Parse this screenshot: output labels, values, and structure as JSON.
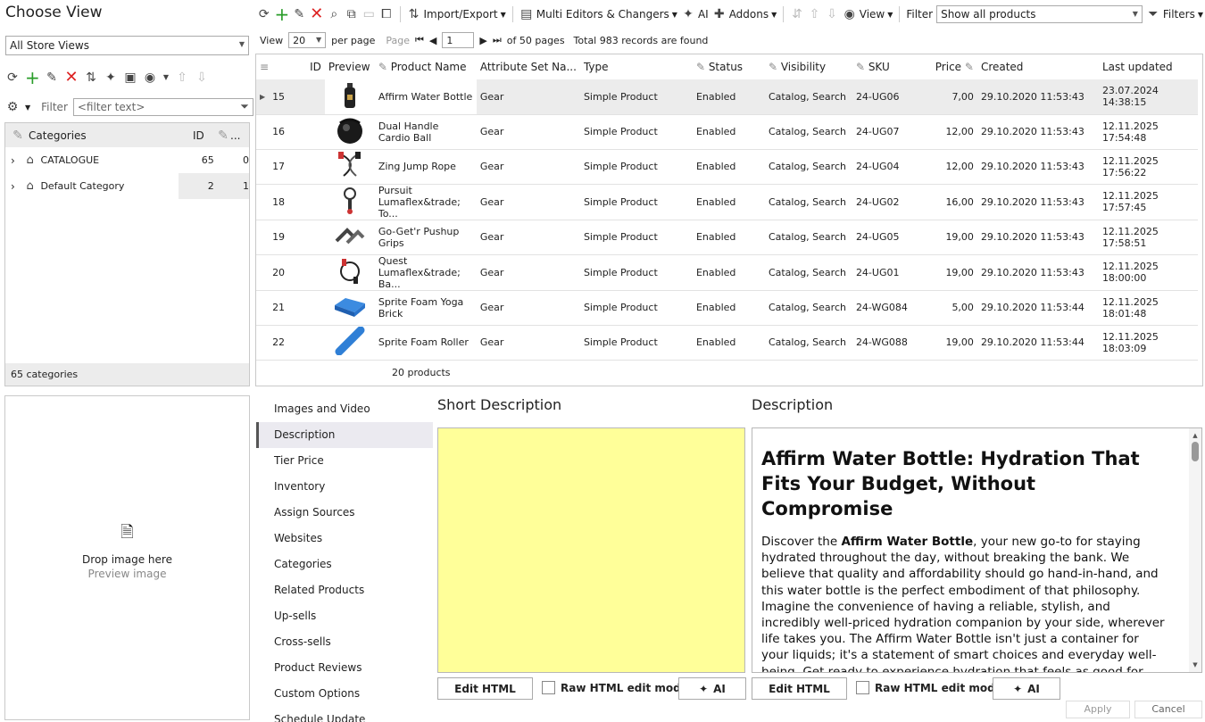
{
  "left": {
    "title": "Choose View",
    "store_view": "All Store Views",
    "filter_label": "Filter",
    "filter_placeholder": "<filter text>",
    "tree_header": {
      "name": "Categories",
      "id": "ID",
      "more": "..."
    },
    "categories": [
      {
        "name": "CATALOGUE",
        "id": "65",
        "count": "0"
      },
      {
        "name": "Default Category",
        "id": "2",
        "count": "1"
      }
    ],
    "footer": "65 categories",
    "dropzone": {
      "title": "Drop image here",
      "subtitle": "Preview image"
    }
  },
  "toolbar": {
    "import_export": "Import/Export",
    "multi_editors": "Multi Editors & Changers",
    "ai": "AI",
    "addons": "Addons",
    "view": "View",
    "filter_label": "Filter",
    "filter_value": "Show all products",
    "filters": "Filters"
  },
  "pager": {
    "view_label": "View",
    "per_page_value": "20",
    "per_page_label": "per page",
    "page_label": "Page",
    "page_value": "1",
    "of_pages": "of 50 pages",
    "total": "Total 983 records are found"
  },
  "grid": {
    "columns": [
      "ID",
      "Preview",
      "Product Name",
      "Attribute Set Na...",
      "Type",
      "Status",
      "Visibility",
      "SKU",
      "Price",
      "Created",
      "Last updated"
    ],
    "rows": [
      {
        "id": "15",
        "name": "Affirm Water Bottle",
        "attr": "Gear",
        "type": "Simple Product",
        "status": "Enabled",
        "vis": "Catalog, Search",
        "sku": "24-UG06",
        "price": "7,00",
        "created": "29.10.2020 11:53:43",
        "updated": "23.07.2024 14:38:15",
        "img": "bottle"
      },
      {
        "id": "16",
        "name": "Dual Handle Cardio Ball",
        "attr": "Gear",
        "type": "Simple Product",
        "status": "Enabled",
        "vis": "Catalog, Search",
        "sku": "24-UG07",
        "price": "12,00",
        "created": "29.10.2020 11:53:43",
        "updated": "12.11.2025 17:54:48",
        "img": "ball"
      },
      {
        "id": "17",
        "name": "Zing Jump Rope",
        "attr": "Gear",
        "type": "Simple Product",
        "status": "Enabled",
        "vis": "Catalog, Search",
        "sku": "24-UG04",
        "price": "12,00",
        "created": "29.10.2020 11:53:43",
        "updated": "12.11.2025 17:56:22",
        "img": "rope"
      },
      {
        "id": "18",
        "name": "Pursuit Lumaflex&trade; To...",
        "attr": "Gear",
        "type": "Simple Product",
        "status": "Enabled",
        "vis": "Catalog, Search",
        "sku": "24-UG02",
        "price": "16,00",
        "created": "29.10.2020 11:53:43",
        "updated": "12.11.2025 17:57:45",
        "img": "tone"
      },
      {
        "id": "19",
        "name": "Go-Get'r Pushup Grips",
        "attr": "Gear",
        "type": "Simple Product",
        "status": "Enabled",
        "vis": "Catalog, Search",
        "sku": "24-UG05",
        "price": "19,00",
        "created": "29.10.2020 11:53:43",
        "updated": "12.11.2025 17:58:51",
        "img": "grips"
      },
      {
        "id": "20",
        "name": "Quest Lumaflex&trade; Ba...",
        "attr": "Gear",
        "type": "Simple Product",
        "status": "Enabled",
        "vis": "Catalog, Search",
        "sku": "24-UG01",
        "price": "19,00",
        "created": "29.10.2020 11:53:43",
        "updated": "12.11.2025 18:00:00",
        "img": "band"
      },
      {
        "id": "21",
        "name": "Sprite Foam Yoga Brick",
        "attr": "Gear",
        "type": "Simple Product",
        "status": "Enabled",
        "vis": "Catalog, Search",
        "sku": "24-WG084",
        "price": "5,00",
        "created": "29.10.2020 11:53:44",
        "updated": "12.11.2025 18:01:48",
        "img": "brick"
      },
      {
        "id": "22",
        "name": "Sprite Foam Roller",
        "attr": "Gear",
        "type": "Simple Product",
        "status": "Enabled",
        "vis": "Catalog, Search",
        "sku": "24-WG088",
        "price": "19,00",
        "created": "29.10.2020 11:53:44",
        "updated": "12.11.2025 18:03:09",
        "img": "roller"
      }
    ],
    "footer": "20 products"
  },
  "tabs": [
    "Images and Video",
    "Description",
    "Tier Price",
    "Inventory",
    "Assign Sources",
    "Websites",
    "Categories",
    "Related Products",
    "Up-sells",
    "Cross-sells",
    "Product Reviews",
    "Custom Options",
    "Schedule Update"
  ],
  "short_desc": {
    "title": "Short Description",
    "edit_html": "Edit HTML",
    "raw_label": "Raw HTML edit mode",
    "ai": "AI"
  },
  "desc": {
    "title": "Description",
    "heading": "Affirm Water Bottle: Hydration That Fits Your Budget, Without Compromise",
    "p_before": "Discover the ",
    "p_bold": "Affirm Water Bottle",
    "p_after": ", your new go-to for staying hydrated throughout the day, without breaking the bank. We believe that quality and affordability should go hand-in-hand, and this water bottle is the perfect embodiment of that philosophy. Imagine the convenience of having a reliable, stylish, and incredibly well-priced hydration companion by your side, wherever life takes you. The Affirm Water Bottle isn't just a container for your liquids; it's a statement of smart choices and everyday well-being. Get ready to experience hydration that feels as good for your wallet as it does for your body.",
    "edit_html": "Edit HTML",
    "raw_label": "Raw HTML edit mode",
    "ai": "AI"
  },
  "actions": {
    "apply": "Apply",
    "cancel": "Cancel"
  },
  "colors": {
    "note_yellow": "#ffff99",
    "grid_selected": "#ececec",
    "tab_active": "#ebeaf0"
  }
}
